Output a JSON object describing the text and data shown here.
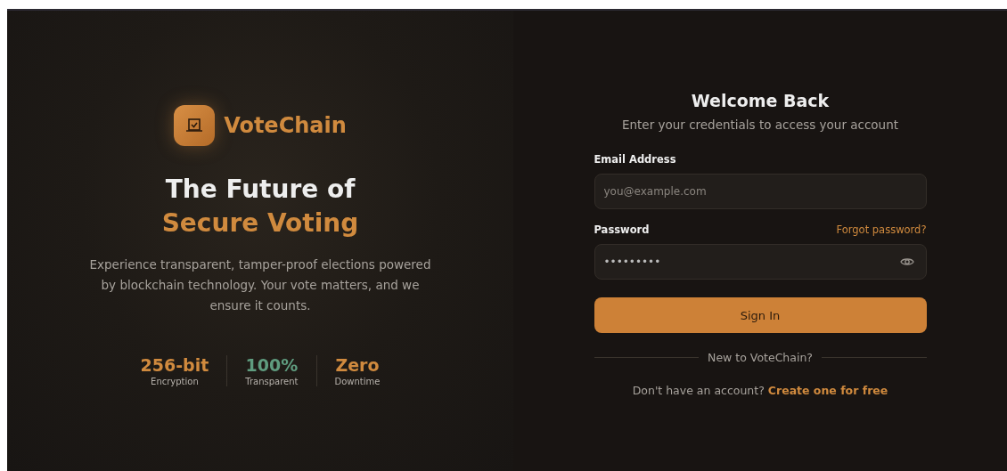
{
  "brand": {
    "name": "VoteChain",
    "headline": "The Future of",
    "headline_accent": "Secure Voting",
    "description": "Experience transparent, tamper-proof elections powered by blockchain technology. Your vote matters, and we ensure it counts."
  },
  "stats": [
    {
      "value": "256-bit",
      "label": "Encryption",
      "color": "#d08a3e"
    },
    {
      "value": "100%",
      "label": "Transparent",
      "color": "#5f9c7f"
    },
    {
      "value": "Zero",
      "label": "Downtime",
      "color": "#d08a3e"
    }
  ],
  "login": {
    "title": "Welcome Back",
    "subtitle": "Enter your credentials to access your account",
    "email": {
      "label": "Email Address",
      "placeholder": "you@example.com"
    },
    "password": {
      "label": "Password",
      "value": "•••••••••",
      "forgot": "Forgot password?"
    },
    "submit": "Sign In",
    "divider": "New to VoteChain?",
    "signup_prompt": "Don't have an account?",
    "signup_link": "Create one for free"
  }
}
